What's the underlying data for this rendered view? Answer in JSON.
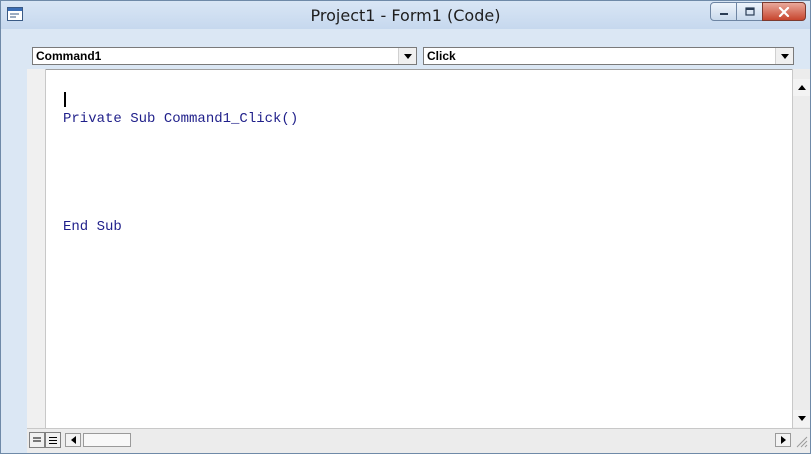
{
  "window": {
    "title": "Project1 - Form1 (Code)"
  },
  "object_combo": {
    "value": "Command1"
  },
  "procedure_combo": {
    "value": "Click"
  },
  "code": {
    "lines": [
      "Private Sub Command1_Click()",
      "",
      "End Sub"
    ]
  },
  "icons": {
    "app": "vb-code-window-icon",
    "minimize": "minimize-icon",
    "maximize": "maximize-icon",
    "close": "close-icon"
  },
  "colors": {
    "keyword": "#1f1f8a",
    "close_button": "#c7452e",
    "frame": "#dbe7f4"
  }
}
